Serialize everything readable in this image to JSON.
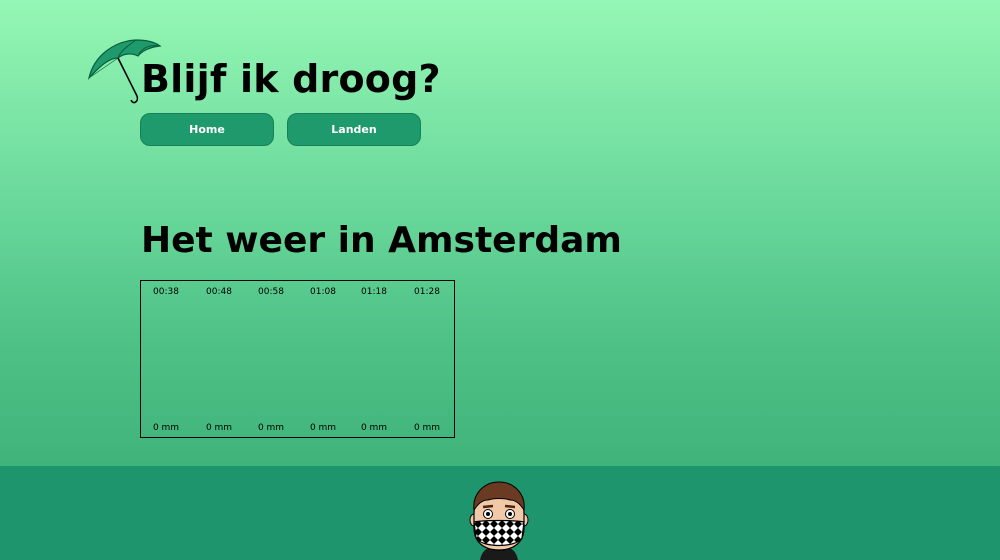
{
  "site": {
    "title": "Blijf ik droog?"
  },
  "nav": [
    {
      "label": "Home"
    },
    {
      "label": "Landen"
    }
  ],
  "page": {
    "heading": "Het weer in Amsterdam"
  },
  "forecast": {
    "times": [
      "00:38",
      "00:48",
      "00:58",
      "01:08",
      "01:18",
      "01:28"
    ],
    "rain_labels": [
      "0 mm",
      "0 mm",
      "0 mm",
      "0 mm",
      "0 mm",
      "0 mm"
    ],
    "rain_mm": [
      0,
      0,
      0,
      0,
      0,
      0
    ]
  },
  "chart_data": {
    "type": "bar",
    "categories": [
      "00:38",
      "00:48",
      "00:58",
      "01:08",
      "01:18",
      "01:28"
    ],
    "values": [
      0,
      0,
      0,
      0,
      0,
      0
    ],
    "unit": "mm"
  },
  "colors": {
    "accent": "#1f9a6c",
    "footer": "#1e956c",
    "bg_top": "#95f7b4",
    "bg_bottom": "#3fb37a"
  },
  "icons": {
    "logo": "umbrella-icon",
    "footer": "avatar-icon"
  }
}
